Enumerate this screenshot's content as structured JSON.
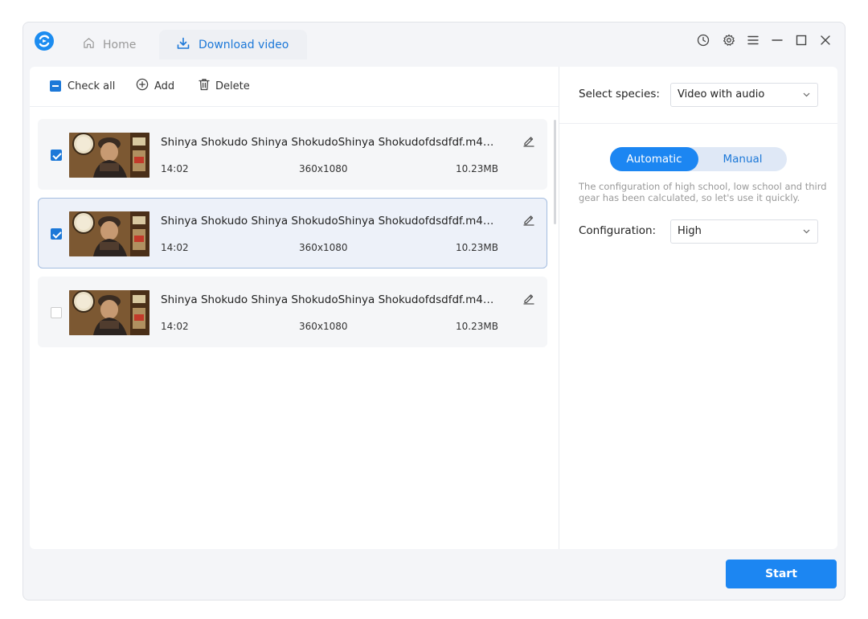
{
  "tabs": {
    "home": "Home",
    "download": "Download video"
  },
  "toolbar": {
    "check_all": "Check all",
    "add": "Add",
    "delete": "Delete"
  },
  "items": [
    {
      "title": "Shinya Shokudo Shinya ShokudoShinya Shokudofdsdfdf.m4a...",
      "duration": "14:02",
      "resolution": "360x1080",
      "size": "10.23MB",
      "checked": true,
      "selected": false
    },
    {
      "title": "Shinya Shokudo Shinya ShokudoShinya Shokudofdsdfdf.m4a...",
      "duration": "14:02",
      "resolution": "360x1080",
      "size": "10.23MB",
      "checked": true,
      "selected": true
    },
    {
      "title": "Shinya Shokudo Shinya ShokudoShinya Shokudofdsdfdf.m4a...",
      "duration": "14:02",
      "resolution": "360x1080",
      "size": "10.23MB",
      "checked": false,
      "selected": false
    }
  ],
  "right": {
    "species_label": "Select species:",
    "species_value": "Video with audio",
    "mode_auto": "Automatic",
    "mode_manual": "Manual",
    "hint": "The configuration of high school, low school and third gear has been calculated, so let's use it quickly.",
    "config_label": "Configuration:",
    "config_value": "High"
  },
  "start_label": "Start",
  "colors": {
    "accent": "#1c86f2",
    "tab_text": "#1c78d8"
  }
}
